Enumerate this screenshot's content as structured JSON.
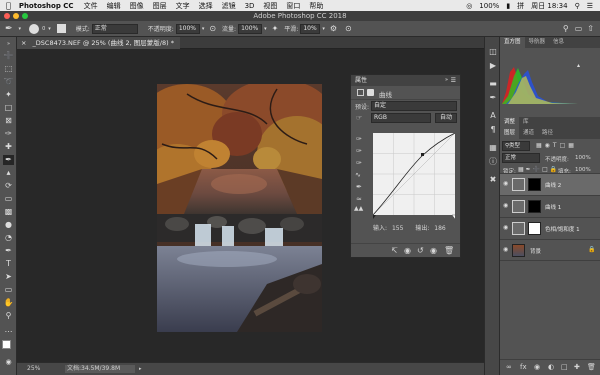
{
  "menubar": {
    "app_name": "Photoshop CC",
    "items": [
      "文件",
      "编辑",
      "图像",
      "图层",
      "文字",
      "选择",
      "滤镜",
      "3D",
      "视图",
      "窗口",
      "帮助"
    ],
    "battery": "100%",
    "clock": "周日 18:34"
  },
  "window": {
    "title": "Adobe Photoshop CC 2018"
  },
  "options": {
    "brush_size": "0",
    "mode_label": "模式:",
    "mode_value": "正常",
    "opacity_label": "不透明度:",
    "opacity_value": "100%",
    "flow_label": "流量:",
    "flow_value": "100%",
    "smooth_label": "平滑:",
    "smooth_value": "10%"
  },
  "document": {
    "tab_title": "_DSC8473.NEF @ 25% (曲线 2, 图层蒙版/8) *",
    "zoom": "25%",
    "doc_info": "文档:34.5M/39.8M"
  },
  "properties": {
    "title": "属性",
    "subtitle": "曲线",
    "preset_label": "预设:",
    "preset_value": "自定",
    "channel_value": "RGB",
    "auto_button": "自动",
    "input_label": "输入:",
    "input_value": "155",
    "output_label": "输出:",
    "output_value": "186"
  },
  "panels": {
    "top_tabs": [
      "直方图",
      "导航器",
      "信息"
    ],
    "adj_tabs": [
      "调整",
      "库"
    ],
    "layer_tabs": [
      "图层",
      "通道",
      "路径"
    ],
    "kind_label": "类型",
    "blend_value": "正常",
    "opacity_label": "不透明度:",
    "opacity_value": "100%",
    "lock_label": "锁定:",
    "fill_label": "填充:",
    "fill_value": "100%",
    "layers": [
      {
        "name": "曲线 2"
      },
      {
        "name": "曲线 1"
      },
      {
        "name": "色相/饱和度 1"
      },
      {
        "name": "背景"
      }
    ]
  },
  "colors": {
    "accent": "#1473e6",
    "panel_bg": "#535353",
    "canvas_bg": "#282828"
  }
}
